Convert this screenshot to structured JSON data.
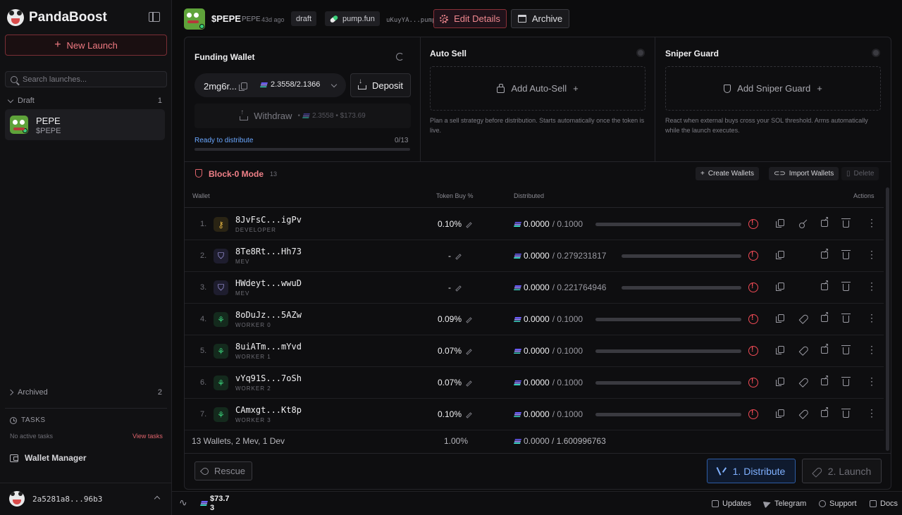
{
  "app": {
    "name": "PandaBoost",
    "new_launch_label": "New Launch",
    "search_placeholder": "Search launches...",
    "draft_label": "Draft",
    "draft_count": "1",
    "launches": [
      {
        "name": "PEPE",
        "ticker": "$PEPE"
      }
    ],
    "archived_label": "Archived",
    "archived_count": "2",
    "tasks_label": "TASKS",
    "no_tasks": "No active tasks",
    "view_tasks": "View tasks",
    "wallet_manager": "Wallet Manager",
    "user_address": "2a5281a8...96b3"
  },
  "header": {
    "ticker": "$PEPE",
    "name": "PEPE",
    "age": "43d ago",
    "status": "draft",
    "platform": "pump.fun",
    "mint": "uKuyYA...pump",
    "edit_label": "Edit Details",
    "archive_label": "Archive"
  },
  "funding_wallet": {
    "title": "Funding Wallet",
    "address": "2mg6r...",
    "balance": "2.3558/2.1366",
    "deposit_label": "Deposit",
    "withdraw_label": "Withdraw",
    "withdraw_balance": "2.3558 • $173.69",
    "ready_label": "Ready to distribute",
    "ready_count": "0/13",
    "ready_progress": 0
  },
  "auto_sell": {
    "title": "Auto Sell",
    "add_label": "Add Auto-Sell",
    "description": "Plan a sell strategy before distribution. Starts automatically once the token is live."
  },
  "sniper_guard": {
    "title": "Sniper Guard",
    "add_label": "Add Sniper Guard",
    "description": "React when external buys cross your SOL threshold. Arms automatically while the launch executes."
  },
  "block0": {
    "title": "Block-0 Mode",
    "count": "13",
    "create_wallets": "Create Wallets",
    "import_wallets": "Import Wallets",
    "delete": "Delete"
  },
  "table": {
    "columns": {
      "wallet": "Wallet",
      "token_buy": "Token Buy %",
      "distributed": "Distributed",
      "actions": "Actions"
    },
    "rows": [
      {
        "num": "1.",
        "address": "8JvFsC...igPv",
        "role": "DEVELOPER",
        "type": "dev",
        "pct": "0.10%",
        "dist": "0.0000",
        "total": "0.1000",
        "actions": [
          "copy",
          "key",
          "ext",
          "trash",
          "more"
        ],
        "progress": 0
      },
      {
        "num": "2.",
        "address": "8Te8Rt...Hh73",
        "role": "MEV",
        "type": "mev",
        "pct": "-",
        "dist": "0.0000",
        "total": "0.279231817",
        "actions": [
          "copy",
          "ext",
          "trash",
          "more"
        ],
        "progress": 0
      },
      {
        "num": "3.",
        "address": "HWdeyt...wwuD",
        "role": "MEV",
        "type": "mev",
        "pct": "-",
        "dist": "0.0000",
        "total": "0.221764946",
        "actions": [
          "copy",
          "ext",
          "trash",
          "more"
        ],
        "progress": 0
      },
      {
        "num": "4.",
        "address": "8oDuJz...5AZw",
        "role": "WORKER 0",
        "type": "worker",
        "pct": "0.09%",
        "dist": "0.0000",
        "total": "0.1000",
        "actions": [
          "copy",
          "rocket",
          "ext",
          "trash",
          "more"
        ],
        "progress": 0
      },
      {
        "num": "5.",
        "address": "8uiATm...mYvd",
        "role": "WORKER 1",
        "type": "worker",
        "pct": "0.07%",
        "dist": "0.0000",
        "total": "0.1000",
        "actions": [
          "copy",
          "rocket",
          "ext",
          "trash",
          "more"
        ],
        "progress": 0
      },
      {
        "num": "6.",
        "address": "vYq91S...7oSh",
        "role": "WORKER 2",
        "type": "worker",
        "pct": "0.07%",
        "dist": "0.0000",
        "total": "0.1000",
        "actions": [
          "copy",
          "rocket",
          "ext",
          "trash",
          "more"
        ],
        "progress": 0
      },
      {
        "num": "7.",
        "address": "CAmxgt...Kt8p",
        "role": "WORKER 3",
        "type": "worker",
        "pct": "0.10%",
        "dist": "0.0000",
        "total": "0.1000",
        "actions": [
          "copy",
          "rocket",
          "ext",
          "trash",
          "more"
        ],
        "progress": 0
      }
    ],
    "summary": "13 Wallets, 2 Mev, 1 Dev",
    "summary_pct": "1.00%",
    "summary_dist": "0.0000 / 1.600996763"
  },
  "footer": {
    "rescue_label": "Rescue",
    "distribute_label": "1. Distribute",
    "launch_label": "2. Launch"
  },
  "statusbar": {
    "price_a": "$73.7",
    "price_b": "3",
    "updates": "Updates",
    "telegram": "Telegram",
    "support": "Support",
    "docs": "Docs"
  },
  "colors": {
    "accent_red": "#e0646c",
    "accent_blue": "#6aa7ff",
    "warning": "#f04a55",
    "background": "#0c0c0d"
  }
}
